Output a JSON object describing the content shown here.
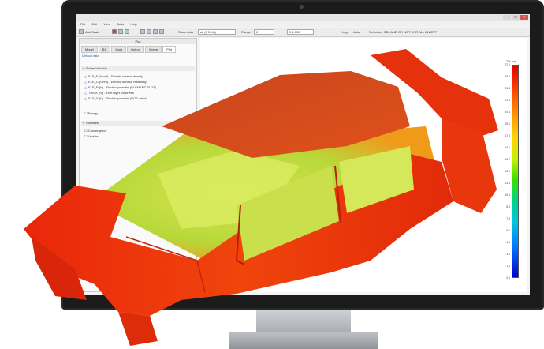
{
  "window": {
    "title": "",
    "controls": [
      "–",
      "□",
      "×"
    ]
  },
  "menubar": {
    "items": [
      "File",
      "Edit",
      "View",
      "Tools",
      "Help"
    ]
  },
  "toolbar": {
    "autoscale_label": "AutoScale",
    "show_label": "Show data",
    "field_value": "all (0 Cells)",
    "range_label": "Range",
    "range_value": "0",
    "range_input": "0 1.000",
    "log_label": "Log",
    "auto_label": "Auto",
    "selection_label": "Selection: OBL AND OR NOT XOR ALL INVERT"
  },
  "left_panel": {
    "title": "Plot",
    "tabs": [
      "Model",
      "BC",
      "Data",
      "Output",
      "Scene",
      "Plot"
    ],
    "active_tab": "Plot",
    "header_link": "Default data",
    "section1_title": "Solver Variable",
    "variables": [
      "ELE_F (A.m2) - Electric current density",
      "ELE_C (Ohm) - Electric surface resistivity",
      "ELE_P (V) - Electric potential (ELEMENT PLOT)",
      "THICK (m) - Film layer thickness",
      "ELE_V (V) - Electric potential (DOF value)"
    ],
    "energy_label": "Energy",
    "section2_title": "Surfaces",
    "surfaces": [
      "Convergence",
      "Update"
    ]
  },
  "legend": {
    "title": "Thk (m)",
    "ticks": [
      "27.0",
      "25.0",
      "23.4",
      "21.9",
      "20.5",
      "19.0",
      "17.6",
      "16.1",
      "14.7",
      "13.2",
      "11.8",
      "10.4",
      "8.9",
      "7.4",
      "6.0",
      "4.5",
      "3.1",
      "1.6",
      "0.0"
    ],
    "colors": [
      "#e10000",
      "#ff8c00",
      "#ffd400",
      "#38e000",
      "#00c6e0",
      "#0000c8"
    ]
  },
  "model": {
    "colors": {
      "body_red": "#e8230a",
      "body_orange": "#ee5a0c",
      "roof": "#d8441a",
      "interior_yellow": "#cfe04a",
      "interior_green": "#9ccb2a"
    }
  }
}
